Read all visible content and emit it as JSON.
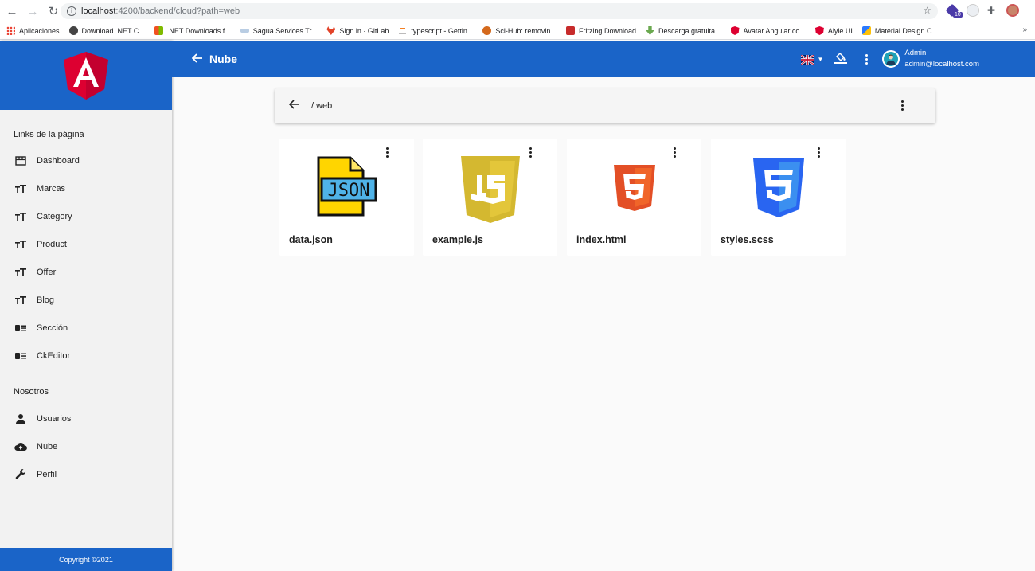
{
  "browser": {
    "url_host": "localhost",
    "url_rest": ":4200/backend/cloud?path=web",
    "bookmarks": [
      {
        "label": "Aplicaciones",
        "icon": "apps-grid-icon",
        "color": "#4285f4"
      },
      {
        "label": "Download .NET C...",
        "icon": "globe-icon",
        "color": "#444444"
      },
      {
        "label": ".NET Downloads f...",
        "icon": "windows-icon",
        "color": "#f25022"
      },
      {
        "label": "Sagua Services Tr...",
        "icon": "sagua-icon",
        "color": "#7aa0c8"
      },
      {
        "label": "Sign in · GitLab",
        "icon": "gitlab-icon",
        "color": "#e24329"
      },
      {
        "label": "typescript - Gettin...",
        "icon": "stackoverflow-icon",
        "color": "#f48024"
      },
      {
        "label": "Sci-Hub: removin...",
        "icon": "scihub-icon",
        "color": "#d4691c"
      },
      {
        "label": "Fritzing Download",
        "icon": "fritzing-icon",
        "color": "#c72b2b"
      },
      {
        "label": "Descarga gratuita...",
        "icon": "download-icon",
        "color": "#6aa84f"
      },
      {
        "label": "Avatar Angular co...",
        "icon": "angular-icon",
        "color": "#dd0031"
      },
      {
        "label": "Alyle UI",
        "icon": "angular-icon",
        "color": "#dd0031"
      },
      {
        "label": "Material Design C...",
        "icon": "material-icon",
        "color": "#2979ff"
      }
    ],
    "more": "»",
    "ext_badge": "10"
  },
  "app": {
    "title": "Nube",
    "user_name": "Admin",
    "user_email": "admin@localhost.com",
    "primary_color": "#1a64c8"
  },
  "sidebar": {
    "section1_title": "Links de la página",
    "links": [
      {
        "label": "Dashboard",
        "icon": "dashboard-icon"
      },
      {
        "label": "Marcas",
        "icon": "text-size-icon"
      },
      {
        "label": "Category",
        "icon": "text-size-icon"
      },
      {
        "label": "Product",
        "icon": "text-size-icon"
      },
      {
        "label": "Offer",
        "icon": "text-size-icon"
      },
      {
        "label": "Blog",
        "icon": "text-size-icon"
      },
      {
        "label": "Sección",
        "icon": "list-icon"
      },
      {
        "label": "CkEditor",
        "icon": "list-icon"
      }
    ],
    "section2_title": "Nosotros",
    "links2": [
      {
        "label": "Usuarios",
        "icon": "person-icon"
      },
      {
        "label": "Nube",
        "icon": "cloud-upload-icon"
      },
      {
        "label": "Perfil",
        "icon": "wrench-icon"
      }
    ],
    "footer": "Copyright ©2021"
  },
  "explorer": {
    "path": "/ web",
    "files": [
      {
        "name": "data.json",
        "icon": "json-file-icon"
      },
      {
        "name": "example.js",
        "icon": "javascript-icon"
      },
      {
        "name": "index.html",
        "icon": "html5-icon"
      },
      {
        "name": "styles.scss",
        "icon": "css3-icon"
      }
    ]
  }
}
